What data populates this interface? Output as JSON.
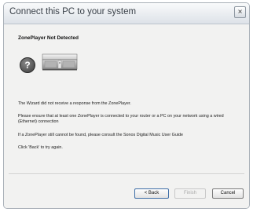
{
  "window": {
    "title": "Connect this PC to your system",
    "close_label": "×"
  },
  "content": {
    "heading": "ZonePlayer Not Detected",
    "help_icon_label": "?",
    "paragraphs": [
      "The Wizard did not receive a response from the ZonePlayer.",
      "Please ensure that at  least one ZonePlayer is connected to your router or a PC on your network using a wired (Ethernet) connection",
      "If a ZonePlayer still cannot be found, please consult the Sonos Digital Music User Guide",
      "Click 'Back' to try again."
    ]
  },
  "footer": {
    "back_label": "< Back",
    "finish_label": "Finish",
    "cancel_label": "Cancel"
  },
  "icons": {
    "help": "help-icon",
    "device": "zoneplayer-device-icon",
    "close": "close-icon"
  }
}
